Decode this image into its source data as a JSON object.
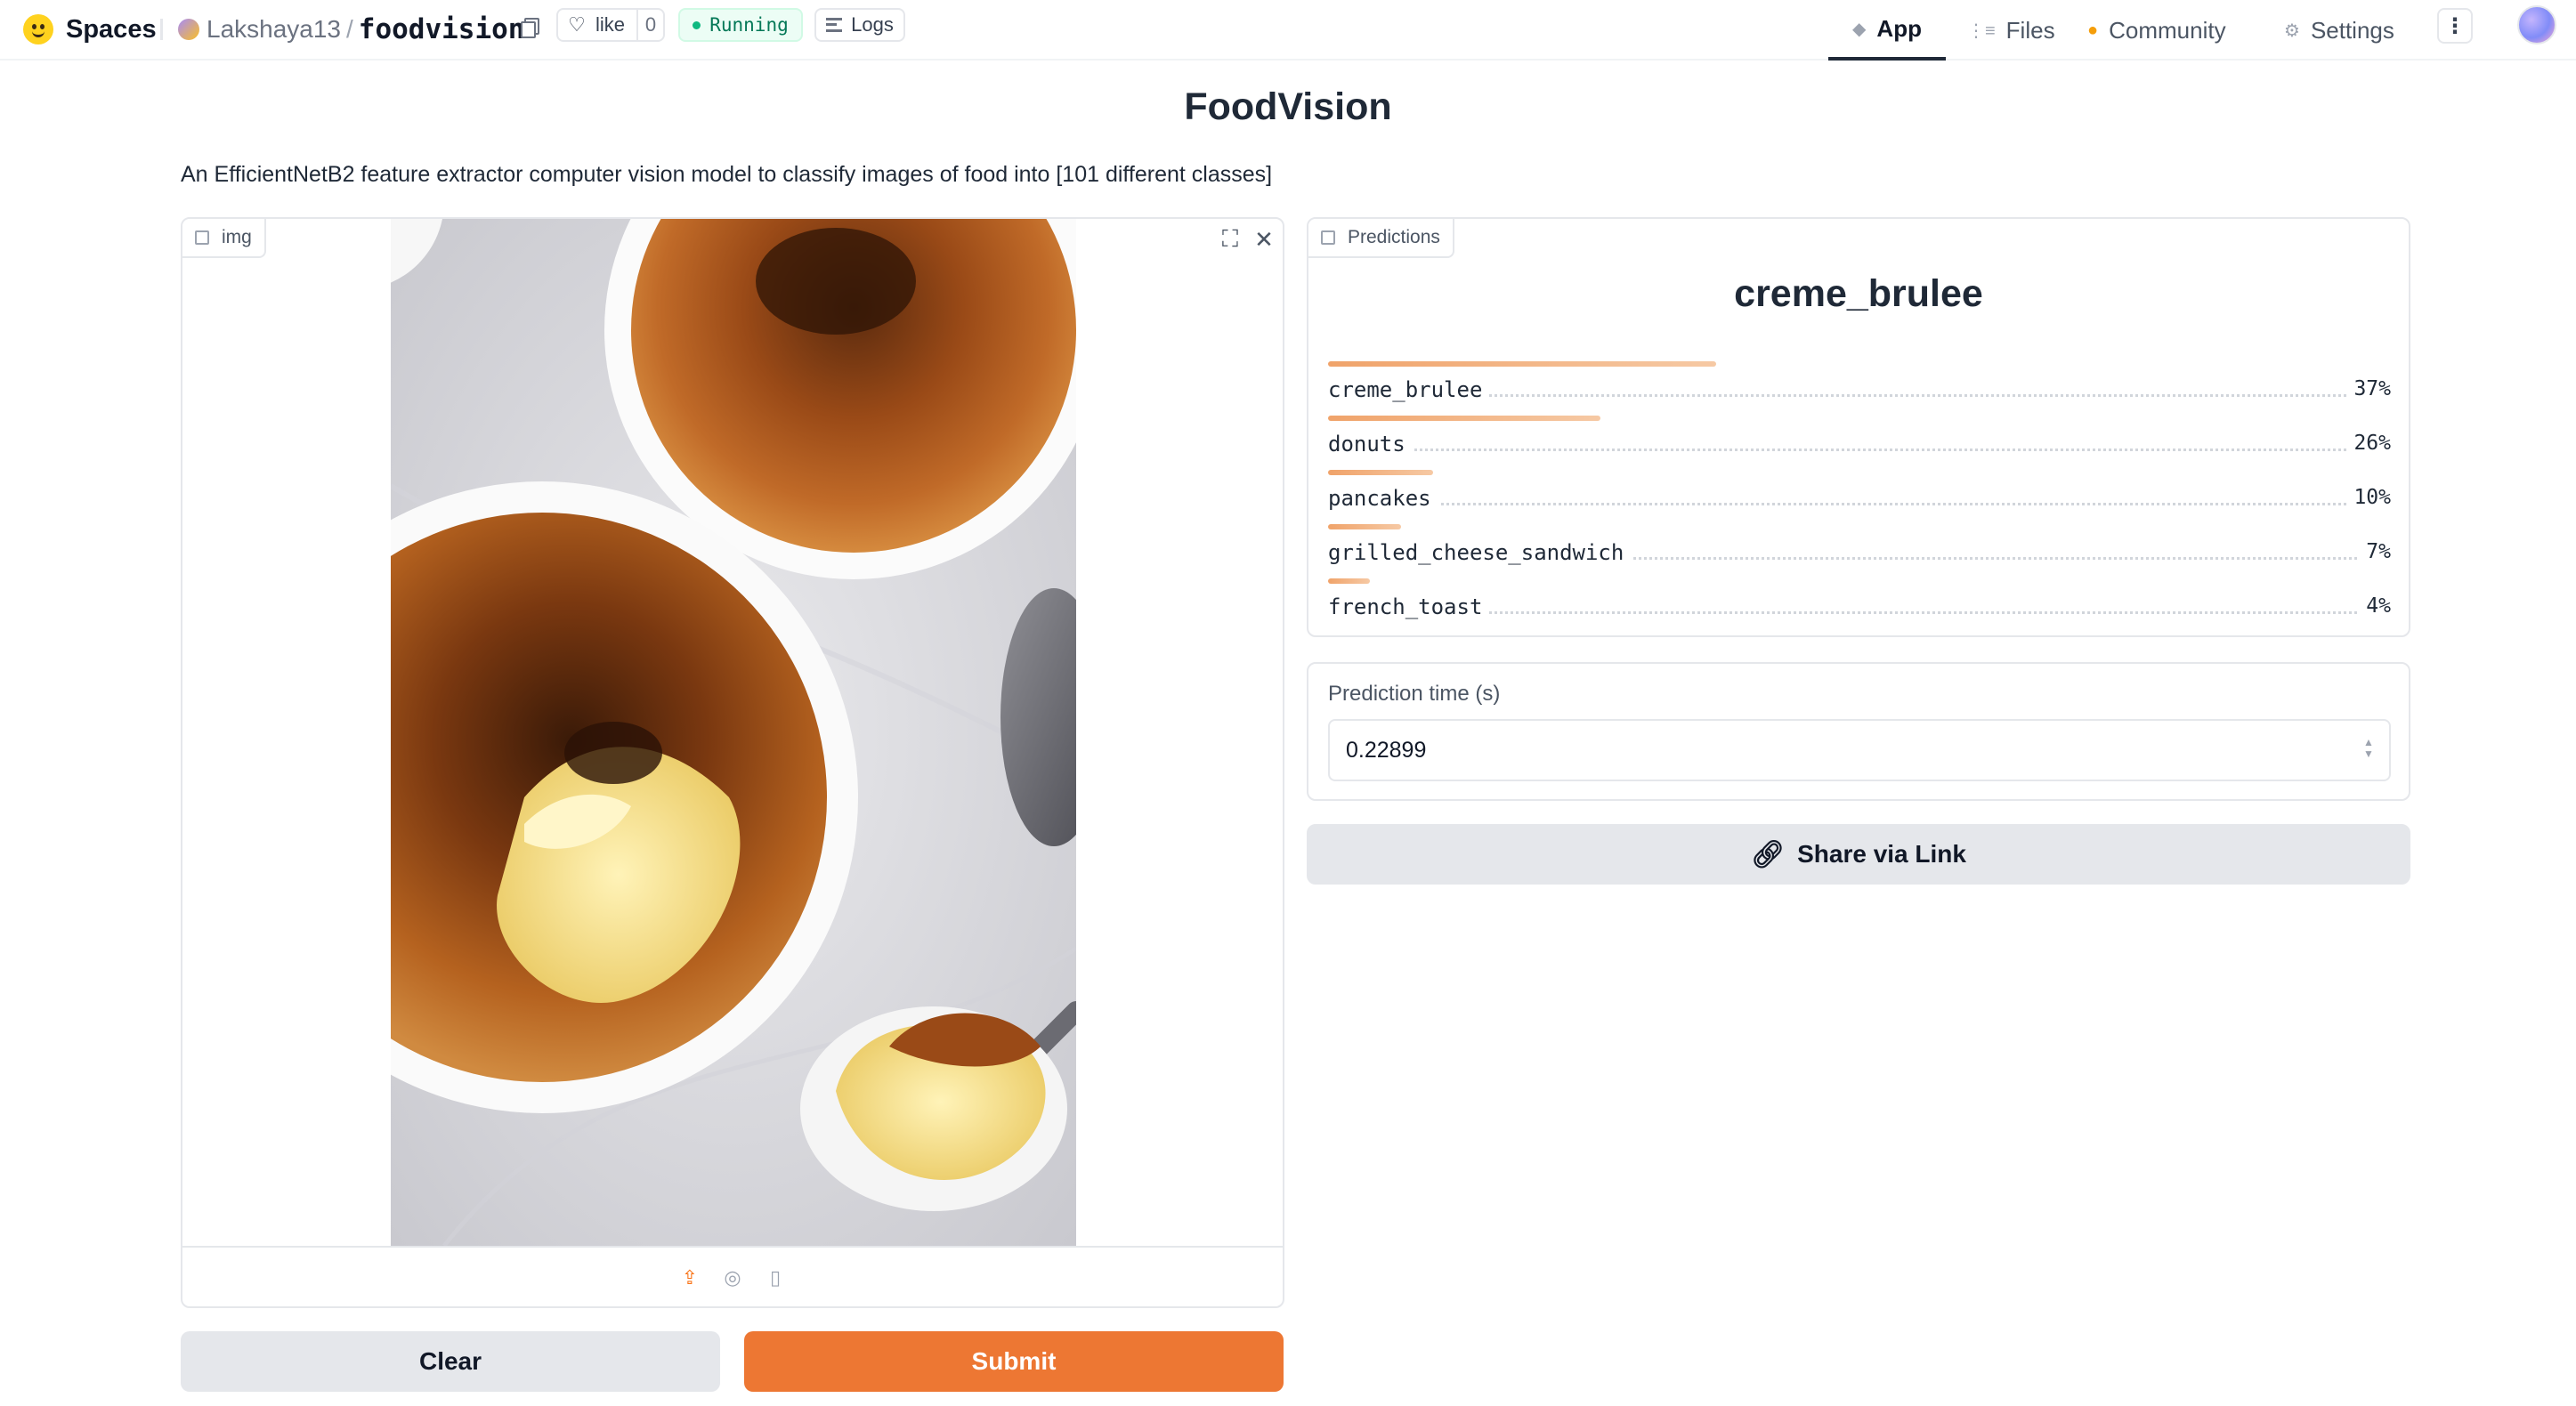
{
  "header": {
    "brand": "Spaces",
    "owner": "Lakshaya13",
    "separator": "/",
    "repo": "foodvision",
    "like_label": "like",
    "like_count": "0",
    "status": "Running",
    "logs_label": "Logs",
    "nav": {
      "app": "App",
      "files": "Files",
      "community": "Community",
      "settings": "Settings"
    },
    "kebab": "⋮"
  },
  "app": {
    "title": "FoodVision",
    "description": "An EfficientNetB2 feature extractor computer vision model to classify images of food into [101 different classes]"
  },
  "image_input": {
    "label": "img"
  },
  "predictions": {
    "label": "Predictions",
    "top_label": "creme_brulee",
    "items": [
      {
        "label": "creme_brulee",
        "pct": "37%",
        "confidence": 0.37
      },
      {
        "label": "donuts",
        "pct": "26%",
        "confidence": 0.26
      },
      {
        "label": "pancakes",
        "pct": "10%",
        "confidence": 0.1
      },
      {
        "label": "grilled_cheese_sandwich",
        "pct": "7%",
        "confidence": 0.07
      },
      {
        "label": "french_toast",
        "pct": "4%",
        "confidence": 0.04
      }
    ]
  },
  "prediction_time": {
    "label": "Prediction time (s)",
    "value": "0.22899"
  },
  "buttons": {
    "share": "Share via Link",
    "clear": "Clear",
    "submit": "Submit"
  },
  "colors": {
    "accent": "#ed7733",
    "bar": "#f0a36a",
    "running": "#10b981"
  }
}
